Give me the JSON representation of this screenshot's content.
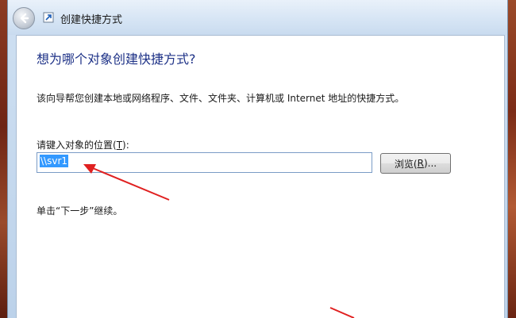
{
  "window": {
    "title": "创建快捷方式"
  },
  "wizard": {
    "heading": "想为哪个对象创建快捷方式?",
    "description": "该向导帮您创建本地或网络程序、文件、文件夹、计算机或 Internet 地址的快捷方式。",
    "location_label_prefix": "请键入对象的位置(",
    "location_label_key": "T",
    "location_label_suffix": "):",
    "location_value": "\\\\svr1",
    "browse_label_prefix": "浏览(",
    "browse_label_key": "R",
    "browse_label_suffix": ")...",
    "hint": "单击“下一步”继续。"
  },
  "icons": {
    "back": "back-arrow-icon",
    "wizard": "shortcut-wizard-icon"
  },
  "colors": {
    "heading": "#1e3287",
    "selection": "#3399ff",
    "annotation": "#e02020"
  }
}
